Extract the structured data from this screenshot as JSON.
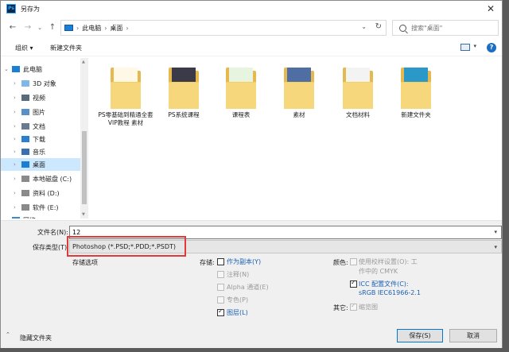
{
  "window": {
    "app_badge": "Ps",
    "title": "另存为",
    "close_label": "✕"
  },
  "nav": {
    "back_label": "←",
    "forward_label": "→",
    "recent_label": "⌄",
    "up_label": "↑",
    "breadcrumbs": [
      "此电脑",
      "桌面"
    ],
    "breadcrumb_sep": "›",
    "refresh_label": "↻",
    "dropdown_label": "⌄",
    "search_placeholder": "搜索\"桌面\""
  },
  "toolbar": {
    "organize_label": "组织 ▾",
    "new_folder_label": "新建文件夹",
    "view_chevron": "▾",
    "help_label": "?"
  },
  "sidebar": {
    "items": [
      {
        "label": "此电脑",
        "chev": "⌄",
        "icon": "computer-icon"
      },
      {
        "label": "3D 对象",
        "chev": "›",
        "icon": "3d-objects-icon"
      },
      {
        "label": "视频",
        "chev": "›",
        "icon": "video-icon"
      },
      {
        "label": "图片",
        "chev": "›",
        "icon": "pictures-icon"
      },
      {
        "label": "文档",
        "chev": "›",
        "icon": "documents-icon"
      },
      {
        "label": "下载",
        "chev": "›",
        "icon": "download-icon"
      },
      {
        "label": "音乐",
        "chev": "›",
        "icon": "music-icon"
      },
      {
        "label": "桌面",
        "chev": "›",
        "icon": "desktop-icon",
        "selected": true
      },
      {
        "label": "本地磁盘 (C:)",
        "chev": "›",
        "icon": "disk-icon"
      },
      {
        "label": "资料 (D:)",
        "chev": "›",
        "icon": "disk-icon"
      },
      {
        "label": "软件 (E:)",
        "chev": "›",
        "icon": "disk-icon"
      },
      {
        "label": "网络",
        "chev": "›",
        "icon": "network-icon"
      }
    ]
  },
  "files": [
    {
      "name": "PS零基础到精通全套VIP教程 素材",
      "paper": "#fff8e6"
    },
    {
      "name": "PS系统课程",
      "paper": "#3a3a48"
    },
    {
      "name": "课程表",
      "paper": "#e7f4e0"
    },
    {
      "name": "素材",
      "paper": "#4f6ea3"
    },
    {
      "name": "文档材料",
      "paper": "#f3f3f3"
    },
    {
      "name": "新建文件夹",
      "paper": "#2a98c8"
    }
  ],
  "save": {
    "filename_label": "文件名(N):",
    "filename_value": "12",
    "filetype_label": "保存类型(T):",
    "filetype_value": "Photoshop (*.PSD;*.PDD;*.PSDT)",
    "save_options_label": "存储选项",
    "store_label": "存储:",
    "as_copy": "作为副本(Y)",
    "notes": "注释(N)",
    "alpha": "Alpha 通道(E)",
    "spot": "专色(P)",
    "layers": "图层(L)",
    "color_label": "颜色:",
    "proof_line1": "使用校样设置(O): 工",
    "proof_line2": "作中的 CMYK",
    "icc_line1": "ICC 配置文件(C):",
    "icc_line2": "sRGB IEC61966-2.1",
    "other_label": "其它:",
    "thumbnail": "缩览图",
    "save_button": "保存(S)",
    "cancel_button": "取消",
    "hide_folders": "隐藏文件夹"
  }
}
